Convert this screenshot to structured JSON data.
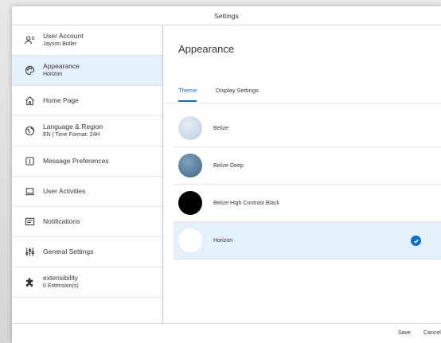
{
  "dialog": {
    "title": "Settings"
  },
  "sidebar": {
    "items": [
      {
        "title": "User Account",
        "subtitle": "Jayson Butler",
        "icon": "user-account-icon"
      },
      {
        "title": "Appearance",
        "subtitle": "Horizon",
        "icon": "palette-icon",
        "selected": true
      },
      {
        "title": "Home Page",
        "subtitle": "",
        "icon": "home-icon"
      },
      {
        "title": "Language & Region",
        "subtitle": "EN | Time Format: 24H",
        "icon": "globe-icon"
      },
      {
        "title": "Message Preferences",
        "subtitle": "",
        "icon": "message-icon"
      },
      {
        "title": "User Activities",
        "subtitle": "",
        "icon": "laptop-icon"
      },
      {
        "title": "Notifications",
        "subtitle": "",
        "icon": "notification-icon"
      },
      {
        "title": "General Settings",
        "subtitle": "",
        "icon": "sliders-icon"
      },
      {
        "title": "extensibility",
        "subtitle": "0 Extension(s)",
        "icon": "puzzle-icon"
      }
    ]
  },
  "main": {
    "title": "Appearance",
    "tabs": [
      {
        "label": "Theme",
        "active": true
      },
      {
        "label": "Display Settings",
        "active": false
      }
    ],
    "themes": [
      {
        "name": "Belize",
        "swatch": "#c9d7e6"
      },
      {
        "name": "Belize Deep",
        "swatch": "#4f7596"
      },
      {
        "name": "Belize High Contrast Black",
        "swatch": "#000000"
      },
      {
        "name": "Horizon",
        "swatch": "#ffffff",
        "selected": true
      }
    ]
  },
  "footer": {
    "save_label": "Save",
    "cancel_label": "Cancel"
  },
  "colors": {
    "accent": "#0a6ed1",
    "selected_bg": "#e5f0fa",
    "text": "#32363a"
  }
}
